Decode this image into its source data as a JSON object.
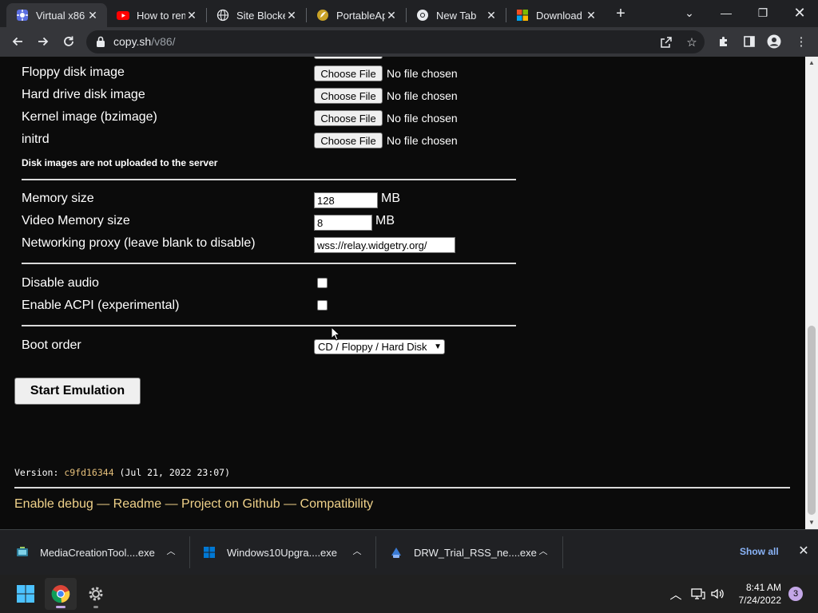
{
  "browser": {
    "tabs": [
      {
        "title": "Virtual x86",
        "favicon": "v86-icon",
        "active": true
      },
      {
        "title": "How to rem",
        "favicon": "youtube-icon"
      },
      {
        "title": "Site Blocke",
        "favicon": "globe-icon"
      },
      {
        "title": "PortableAp",
        "favicon": "portableapps-icon"
      },
      {
        "title": "New Tab",
        "favicon": "chrome-icon"
      },
      {
        "title": "Download",
        "favicon": "microsoft-icon"
      }
    ],
    "url_domain": "copy.sh",
    "url_path": "/v86/"
  },
  "form": {
    "file_inputs": [
      {
        "label": "Floppy disk image",
        "button": "Choose File",
        "status": "No file chosen"
      },
      {
        "label": "Hard drive disk image",
        "button": "Choose File",
        "status": "No file chosen"
      },
      {
        "label": "Kernel image (bzimage)",
        "button": "Choose File",
        "status": "No file chosen"
      },
      {
        "label": "initrd",
        "button": "Choose File",
        "status": "No file chosen"
      }
    ],
    "disk_note": "Disk images are not uploaded to the server",
    "memory_label": "Memory size",
    "memory_value": "128",
    "memory_unit": "MB",
    "video_memory_label": "Video Memory size",
    "video_memory_value": "8",
    "video_memory_unit": "MB",
    "proxy_label": "Networking proxy (leave blank to disable)",
    "proxy_value": "wss://relay.widgetry.org/",
    "disable_audio_label": "Disable audio",
    "disable_audio_checked": false,
    "acpi_label": "Enable ACPI (experimental)",
    "acpi_checked": false,
    "boot_order_label": "Boot order",
    "boot_order_value": "CD / Floppy / Hard Disk",
    "start_button": "Start Emulation"
  },
  "footer": {
    "version_prefix": "Version: ",
    "version_hash": "c9fd16344",
    "version_date": " (Jul 21, 2022 23:07)",
    "links": [
      "Enable debug",
      "Readme",
      "Project on Github",
      "Compatibility"
    ],
    "separator": " — "
  },
  "downloads": {
    "items": [
      {
        "name": "MediaCreationTool....exe",
        "icon": "media-creation-tool-icon"
      },
      {
        "name": "Windows10Upgra....exe",
        "icon": "windows-icon"
      },
      {
        "name": "DRW_Trial_RSS_ne....exe",
        "icon": "drw-installer-icon"
      }
    ],
    "show_all": "Show all"
  },
  "taskbar": {
    "time": "8:41 AM",
    "date": "7/24/2022",
    "notification_count": "3"
  },
  "colors": {
    "link": "#f0d28a",
    "hash": "#e6c07b",
    "show_all": "#8ab4f8",
    "notif": "#c4a7e7"
  }
}
